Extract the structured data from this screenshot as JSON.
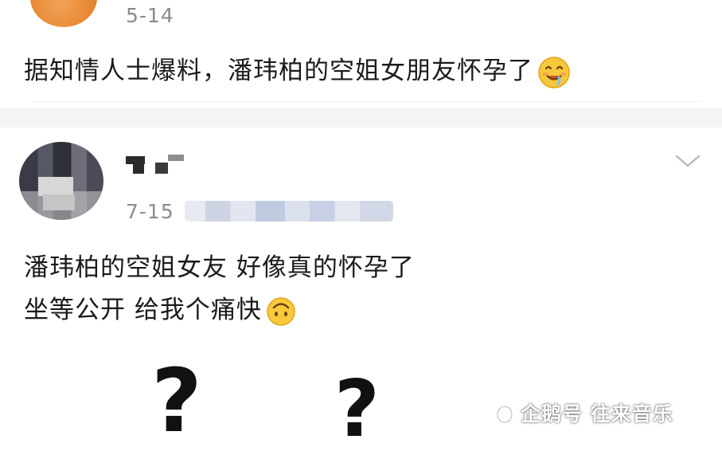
{
  "post1": {
    "date": "5-14",
    "text": "据知情人士爆料，潘玮柏的空姐女朋友怀孕了",
    "emoji": "drooling-face"
  },
  "post2": {
    "date": "7-15",
    "line1": "潘玮柏的空姐女友  好像真的怀孕了",
    "line2": "坐等公开 给我个痛快",
    "emoji": "upside-down-face",
    "qmarks": [
      "?",
      "?"
    ]
  },
  "watermark": {
    "text": "企鹅号 往来音乐"
  }
}
